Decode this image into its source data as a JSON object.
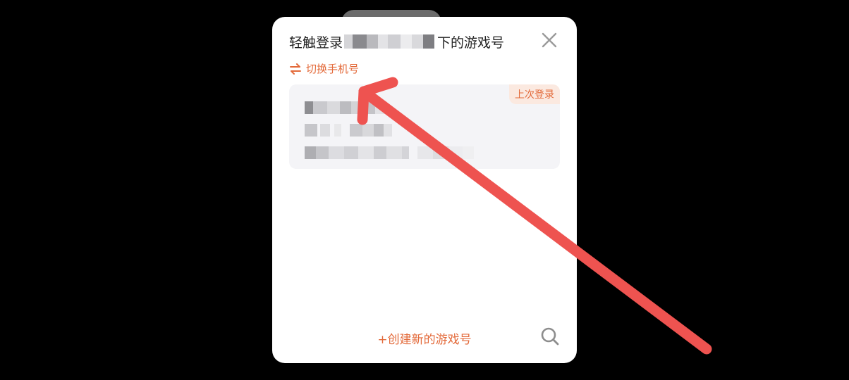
{
  "dialog": {
    "title_prefix": "轻触登录",
    "title_suffix": "下的游戏号",
    "switch_phone_label": "切换手机号",
    "last_login_badge": "上次登录",
    "create_account_label": "+创建新的游戏号"
  },
  "colors": {
    "accent": "#e36a3a",
    "annotation_arrow": "#ee5350",
    "card_background": "#f4f4f7"
  },
  "icons": {
    "close": "close-icon",
    "switch": "swap-arrows-icon",
    "search": "search-icon"
  }
}
